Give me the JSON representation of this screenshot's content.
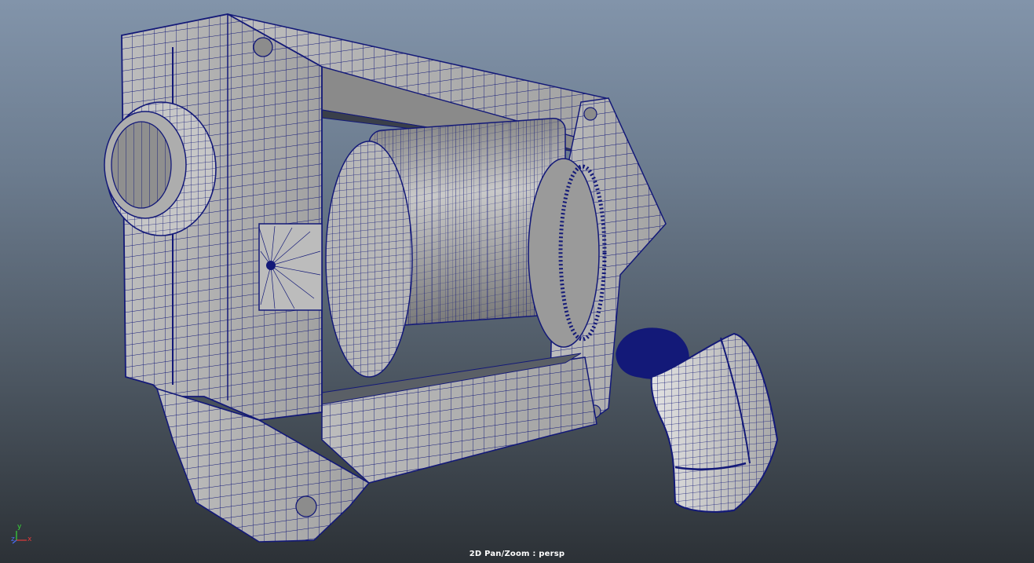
{
  "viewport": {
    "hud_label": "2D Pan/Zoom : persp",
    "axis": {
      "x": "x",
      "y": "y",
      "z": "z"
    }
  },
  "colors": {
    "wireframe": "#131978",
    "shaded_surface": "#9a9a9a",
    "background_top": "#8294aa",
    "background_bottom": "#2c3136"
  },
  "icons": [
    "axis-gizmo-icon"
  ]
}
